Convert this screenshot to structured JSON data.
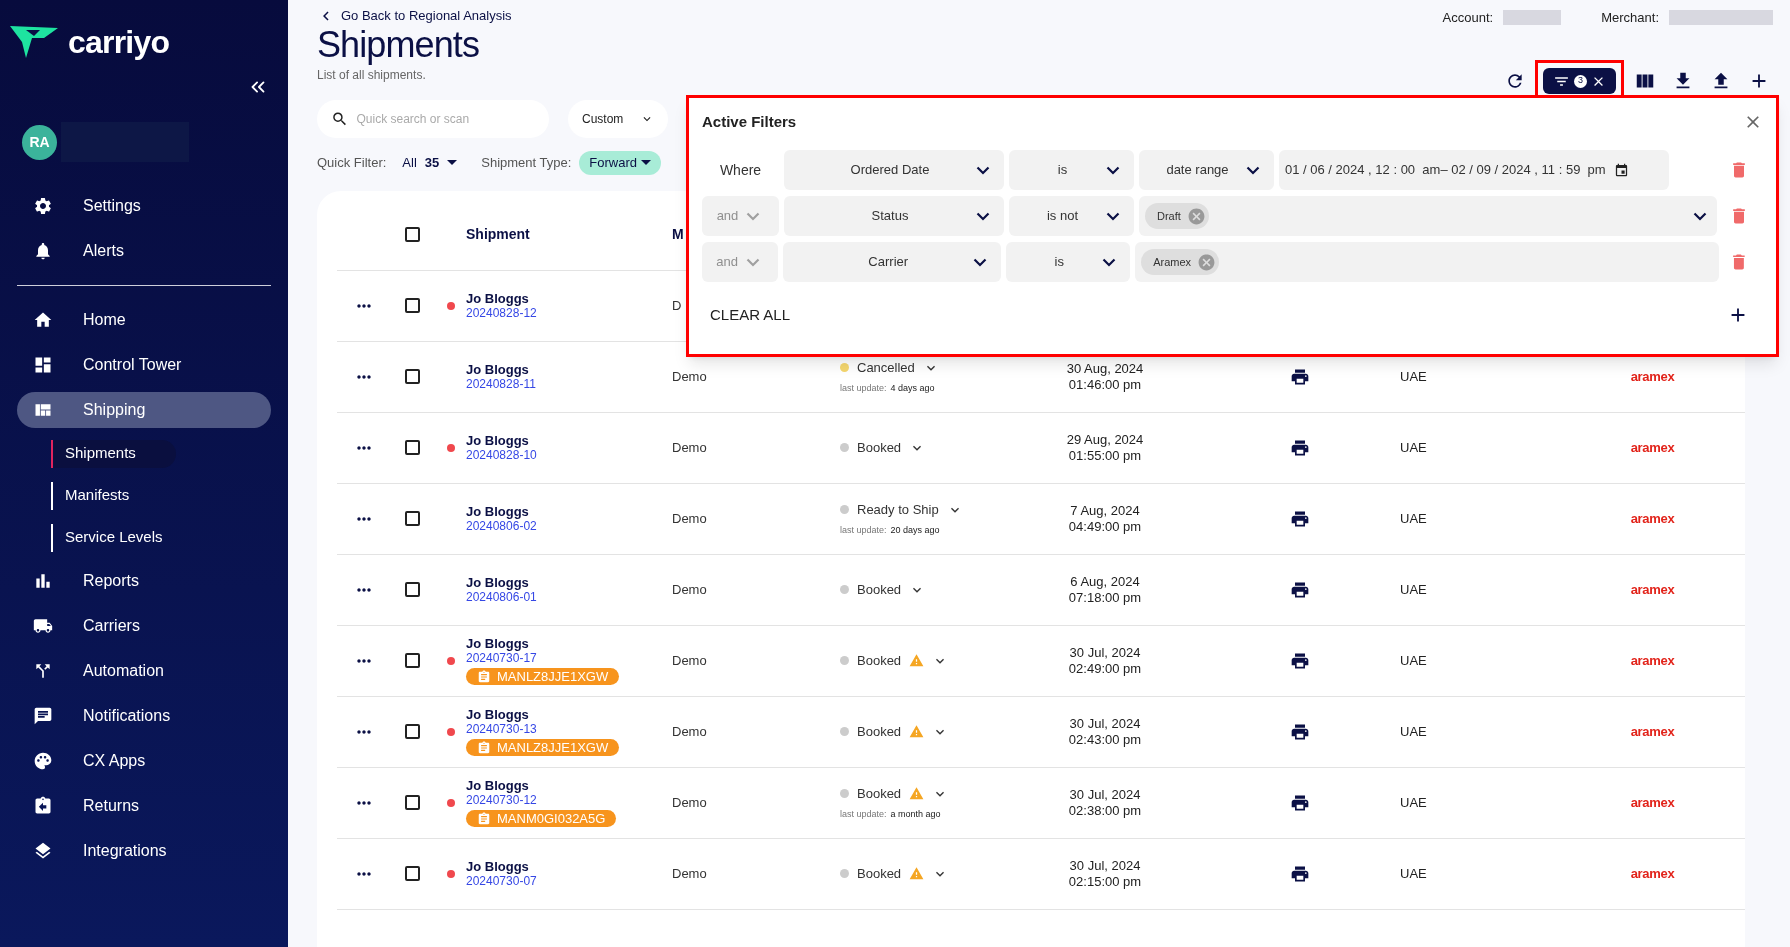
{
  "brand": {
    "name": "carriyo"
  },
  "user": {
    "initials": "RA"
  },
  "sidebar": {
    "top_items": [
      {
        "label": "Settings",
        "selected": false
      },
      {
        "label": "Alerts",
        "selected": false
      }
    ],
    "items": [
      {
        "label": "Home",
        "selected": false
      },
      {
        "label": "Control Tower",
        "selected": false
      },
      {
        "label": "Shipping",
        "selected": true,
        "children": [
          {
            "label": "Shipments",
            "selected": true
          },
          {
            "label": "Manifests",
            "selected": false
          },
          {
            "label": "Service Levels",
            "selected": false
          }
        ]
      },
      {
        "label": "Reports",
        "selected": false
      },
      {
        "label": "Carriers",
        "selected": false
      },
      {
        "label": "Automation",
        "selected": false
      },
      {
        "label": "Notifications",
        "selected": false
      },
      {
        "label": "CX Apps",
        "selected": false
      },
      {
        "label": "Returns",
        "selected": false
      },
      {
        "label": "Integrations",
        "selected": false
      }
    ]
  },
  "header": {
    "back_link": "Go Back to Regional Analysis",
    "title": "Shipments",
    "subtitle": "List of all shipments.",
    "account_label": "Account:",
    "merchant_label": "Merchant:"
  },
  "toolbar": {
    "filter_count": "3"
  },
  "search": {
    "placeholder": "Quick search or scan"
  },
  "date_preset": "Custom",
  "quick_filter": {
    "label": "Quick Filter:",
    "value": "All",
    "count": "35",
    "type_label": "Shipment Type:",
    "type_value": "Forward"
  },
  "active_filters": {
    "title": "Active Filters",
    "clear_label": "CLEAR ALL",
    "filters": [
      {
        "conjunction": {
          "kind": "label",
          "label": "Where"
        },
        "field": "Ordered Date",
        "operator": "is",
        "value": {
          "kind": "date_range",
          "mode": "date range",
          "text": "01 / 06 / 2024 , 12 : 00  am– 02 / 09 / 2024 , 11 : 59  pm"
        }
      },
      {
        "conjunction": {
          "kind": "select",
          "label": "and"
        },
        "field": "Status",
        "operator": "is not",
        "value": {
          "kind": "chips",
          "chips": [
            "Draft"
          ],
          "dropdown": true
        }
      },
      {
        "conjunction": {
          "kind": "select",
          "label": "and"
        },
        "field": "Carrier",
        "operator": "is",
        "value": {
          "kind": "chips",
          "chips": [
            "Aramex"
          ],
          "dropdown": false
        }
      }
    ]
  },
  "table": {
    "columns": [
      "Shipment",
      "M"
    ],
    "all_checked": false,
    "rows": [
      {
        "alert": true,
        "checked": false,
        "name": "Jo Bloggs",
        "id": "20240828-12",
        "merchant": "D"
      },
      {
        "alert": false,
        "checked": false,
        "name": "Jo Bloggs",
        "id": "20240828-11",
        "merchant": "Demo",
        "status": {
          "label": "Cancelled",
          "color": "#f5d76e",
          "warning": false,
          "last_update_label": "last update:",
          "last_update": "4 days ago"
        },
        "date": "30 Aug, 2024",
        "time": "01:46:00 pm",
        "country": "UAE",
        "carrier": "aramex"
      },
      {
        "alert": true,
        "checked": false,
        "name": "Jo Bloggs",
        "id": "20240828-10",
        "merchant": "Demo",
        "status": {
          "label": "Booked",
          "color": "#cccccc",
          "warning": false
        },
        "date": "29 Aug, 2024",
        "time": "01:55:00 pm",
        "country": "UAE",
        "carrier": "aramex"
      },
      {
        "alert": false,
        "checked": false,
        "name": "Jo Bloggs",
        "id": "20240806-02",
        "merchant": "Demo",
        "status": {
          "label": "Ready to Ship",
          "color": "#cccccc",
          "warning": false,
          "last_update_label": "last update:",
          "last_update": "20 days ago"
        },
        "date": "7 Aug, 2024",
        "time": "04:49:00 pm",
        "country": "UAE",
        "carrier": "aramex"
      },
      {
        "alert": false,
        "checked": false,
        "name": "Jo Bloggs",
        "id": "20240806-01",
        "merchant": "Demo",
        "status": {
          "label": "Booked",
          "color": "#cccccc",
          "warning": false
        },
        "date": "6 Aug, 2024",
        "time": "07:18:00 pm",
        "country": "UAE",
        "carrier": "aramex"
      },
      {
        "alert": true,
        "checked": false,
        "name": "Jo Bloggs",
        "id": "20240730-17",
        "tag": "MANLZ8JJE1XGW",
        "merchant": "Demo",
        "status": {
          "label": "Booked",
          "color": "#cccccc",
          "warning": true
        },
        "date": "30 Jul, 2024",
        "time": "02:49:00 pm",
        "country": "UAE",
        "carrier": "aramex"
      },
      {
        "alert": true,
        "checked": false,
        "name": "Jo Bloggs",
        "id": "20240730-13",
        "tag": "MANLZ8JJE1XGW",
        "merchant": "Demo",
        "status": {
          "label": "Booked",
          "color": "#cccccc",
          "warning": true
        },
        "date": "30 Jul, 2024",
        "time": "02:43:00 pm",
        "country": "UAE",
        "carrier": "aramex"
      },
      {
        "alert": true,
        "checked": false,
        "name": "Jo Bloggs",
        "id": "20240730-12",
        "tag": "MANM0GI032A5G",
        "merchant": "Demo",
        "status": {
          "label": "Booked",
          "color": "#cccccc",
          "warning": true,
          "last_update_label": "last update:",
          "last_update": "a month ago"
        },
        "date": "30 Jul, 2024",
        "time": "02:38:00 pm",
        "country": "UAE",
        "carrier": "aramex"
      },
      {
        "alert": true,
        "checked": false,
        "name": "Jo Bloggs",
        "id": "20240730-07",
        "merchant": "Demo",
        "status": {
          "label": "Booked",
          "color": "#cccccc",
          "warning": true
        },
        "date": "30 Jul, 2024",
        "time": "02:15:00 pm",
        "country": "UAE",
        "carrier": "aramex"
      }
    ]
  }
}
